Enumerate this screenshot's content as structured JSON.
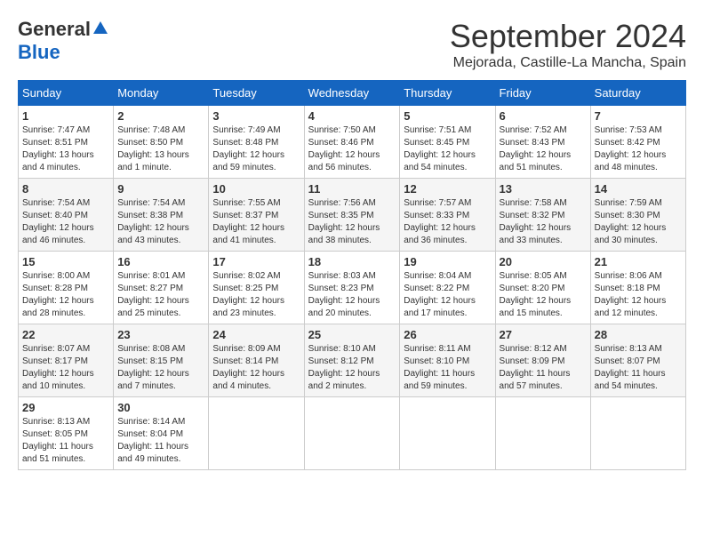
{
  "header": {
    "logo_general": "General",
    "logo_blue": "Blue",
    "title": "September 2024",
    "location": "Mejorada, Castille-La Mancha, Spain"
  },
  "days_of_week": [
    "Sunday",
    "Monday",
    "Tuesday",
    "Wednesday",
    "Thursday",
    "Friday",
    "Saturday"
  ],
  "weeks": [
    [
      {
        "day": "1",
        "info": "Sunrise: 7:47 AM\nSunset: 8:51 PM\nDaylight: 13 hours\nand 4 minutes."
      },
      {
        "day": "2",
        "info": "Sunrise: 7:48 AM\nSunset: 8:50 PM\nDaylight: 13 hours\nand 1 minute."
      },
      {
        "day": "3",
        "info": "Sunrise: 7:49 AM\nSunset: 8:48 PM\nDaylight: 12 hours\nand 59 minutes."
      },
      {
        "day": "4",
        "info": "Sunrise: 7:50 AM\nSunset: 8:46 PM\nDaylight: 12 hours\nand 56 minutes."
      },
      {
        "day": "5",
        "info": "Sunrise: 7:51 AM\nSunset: 8:45 PM\nDaylight: 12 hours\nand 54 minutes."
      },
      {
        "day": "6",
        "info": "Sunrise: 7:52 AM\nSunset: 8:43 PM\nDaylight: 12 hours\nand 51 minutes."
      },
      {
        "day": "7",
        "info": "Sunrise: 7:53 AM\nSunset: 8:42 PM\nDaylight: 12 hours\nand 48 minutes."
      }
    ],
    [
      {
        "day": "8",
        "info": "Sunrise: 7:54 AM\nSunset: 8:40 PM\nDaylight: 12 hours\nand 46 minutes."
      },
      {
        "day": "9",
        "info": "Sunrise: 7:54 AM\nSunset: 8:38 PM\nDaylight: 12 hours\nand 43 minutes."
      },
      {
        "day": "10",
        "info": "Sunrise: 7:55 AM\nSunset: 8:37 PM\nDaylight: 12 hours\nand 41 minutes."
      },
      {
        "day": "11",
        "info": "Sunrise: 7:56 AM\nSunset: 8:35 PM\nDaylight: 12 hours\nand 38 minutes."
      },
      {
        "day": "12",
        "info": "Sunrise: 7:57 AM\nSunset: 8:33 PM\nDaylight: 12 hours\nand 36 minutes."
      },
      {
        "day": "13",
        "info": "Sunrise: 7:58 AM\nSunset: 8:32 PM\nDaylight: 12 hours\nand 33 minutes."
      },
      {
        "day": "14",
        "info": "Sunrise: 7:59 AM\nSunset: 8:30 PM\nDaylight: 12 hours\nand 30 minutes."
      }
    ],
    [
      {
        "day": "15",
        "info": "Sunrise: 8:00 AM\nSunset: 8:28 PM\nDaylight: 12 hours\nand 28 minutes."
      },
      {
        "day": "16",
        "info": "Sunrise: 8:01 AM\nSunset: 8:27 PM\nDaylight: 12 hours\nand 25 minutes."
      },
      {
        "day": "17",
        "info": "Sunrise: 8:02 AM\nSunset: 8:25 PM\nDaylight: 12 hours\nand 23 minutes."
      },
      {
        "day": "18",
        "info": "Sunrise: 8:03 AM\nSunset: 8:23 PM\nDaylight: 12 hours\nand 20 minutes."
      },
      {
        "day": "19",
        "info": "Sunrise: 8:04 AM\nSunset: 8:22 PM\nDaylight: 12 hours\nand 17 minutes."
      },
      {
        "day": "20",
        "info": "Sunrise: 8:05 AM\nSunset: 8:20 PM\nDaylight: 12 hours\nand 15 minutes."
      },
      {
        "day": "21",
        "info": "Sunrise: 8:06 AM\nSunset: 8:18 PM\nDaylight: 12 hours\nand 12 minutes."
      }
    ],
    [
      {
        "day": "22",
        "info": "Sunrise: 8:07 AM\nSunset: 8:17 PM\nDaylight: 12 hours\nand 10 minutes."
      },
      {
        "day": "23",
        "info": "Sunrise: 8:08 AM\nSunset: 8:15 PM\nDaylight: 12 hours\nand 7 minutes."
      },
      {
        "day": "24",
        "info": "Sunrise: 8:09 AM\nSunset: 8:14 PM\nDaylight: 12 hours\nand 4 minutes."
      },
      {
        "day": "25",
        "info": "Sunrise: 8:10 AM\nSunset: 8:12 PM\nDaylight: 12 hours\nand 2 minutes."
      },
      {
        "day": "26",
        "info": "Sunrise: 8:11 AM\nSunset: 8:10 PM\nDaylight: 11 hours\nand 59 minutes."
      },
      {
        "day": "27",
        "info": "Sunrise: 8:12 AM\nSunset: 8:09 PM\nDaylight: 11 hours\nand 57 minutes."
      },
      {
        "day": "28",
        "info": "Sunrise: 8:13 AM\nSunset: 8:07 PM\nDaylight: 11 hours\nand 54 minutes."
      }
    ],
    [
      {
        "day": "29",
        "info": "Sunrise: 8:13 AM\nSunset: 8:05 PM\nDaylight: 11 hours\nand 51 minutes."
      },
      {
        "day": "30",
        "info": "Sunrise: 8:14 AM\nSunset: 8:04 PM\nDaylight: 11 hours\nand 49 minutes."
      },
      null,
      null,
      null,
      null,
      null
    ]
  ]
}
